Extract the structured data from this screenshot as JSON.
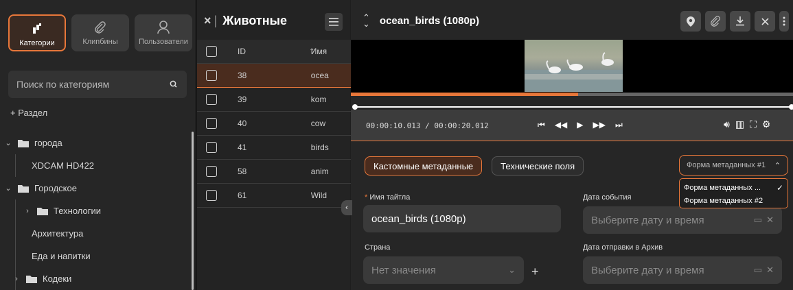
{
  "sidebar": {
    "tabs": [
      {
        "label": "Категории",
        "icon": "categories-icon",
        "active": true
      },
      {
        "label": "Клипбины",
        "icon": "paperclip-icon",
        "active": false
      },
      {
        "label": "Пользователи",
        "icon": "user-icon",
        "active": false
      }
    ],
    "search_placeholder": "Поиск по категориям",
    "add_section": "+ Раздел",
    "tree": [
      {
        "label": "города",
        "level": 0,
        "expanded": true,
        "folder": true
      },
      {
        "label": "XDCAM HD422",
        "level": 1,
        "folder": false
      },
      {
        "label": "Городское",
        "level": 0,
        "expanded": true,
        "folder": true
      },
      {
        "label": "Технологии",
        "level": 1,
        "expanded": false,
        "folder": true
      },
      {
        "label": "Архитектура",
        "level": 1,
        "folder": false
      },
      {
        "label": "Еда и напитки",
        "level": 1,
        "folder": false
      },
      {
        "label": "Кодеки",
        "level": 0,
        "expanded": false,
        "folder": true
      }
    ]
  },
  "list": {
    "close": "×",
    "separator": "|",
    "title": "Животные",
    "columns": {
      "id": "ID",
      "name": "Имя"
    },
    "rows": [
      {
        "id": "38",
        "name": "ocea",
        "selected": true
      },
      {
        "id": "39",
        "name": "kom",
        "selected": false
      },
      {
        "id": "40",
        "name": "cow",
        "selected": false
      },
      {
        "id": "41",
        "name": "birds",
        "selected": false
      },
      {
        "id": "58",
        "name": "anim",
        "selected": false
      },
      {
        "id": "61",
        "name": "Wild",
        "selected": false
      }
    ],
    "collapse_glyph": "‹"
  },
  "detail": {
    "up_down": "⌃⌄",
    "title": "ocean_birds (1080p)",
    "progress": 0.514,
    "timecode": "00:00:10.013 / 00:00:20.012",
    "meta_tabs": [
      "Кастомные метаданные",
      "Технические поля"
    ],
    "form_select": "Форма метаданных #1",
    "form_options": [
      {
        "label": "Форма метаданных ...",
        "checked": true
      },
      {
        "label": "Форма метаданных #2",
        "checked": false
      }
    ],
    "fields": {
      "title_label": "Имя тайтла",
      "title_required": "*",
      "title_value": "ocean_birds (1080p)",
      "event_date_label": "Дата события",
      "event_date_placeholder": "Выберите дату и время",
      "country_label": "Страна",
      "country_placeholder": "Нет значения",
      "archive_date_label": "Дата отправки в Архив",
      "archive_date_placeholder": "Выберите дату и время",
      "add_glyph": "+"
    }
  },
  "colors": {
    "accent": "#e8773a",
    "bg": "#262626",
    "selected_row": "#4a2c1e"
  }
}
